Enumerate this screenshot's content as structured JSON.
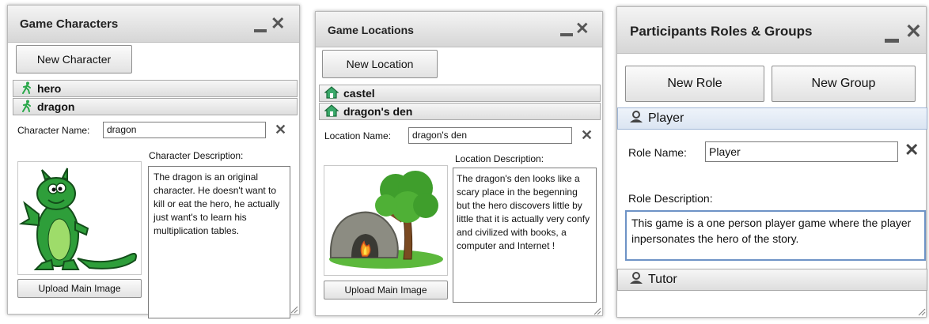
{
  "characters": {
    "title": "Game Characters",
    "new_button": "New Character",
    "items": [
      {
        "label": "hero",
        "icon": "walking-figure-icon"
      },
      {
        "label": "dragon",
        "icon": "walking-figure-icon"
      }
    ],
    "name_label": "Character Name:",
    "name_value": "dragon",
    "desc_label": "Character Description:",
    "desc_text": "The dragon is an original character. He doesn't want to kill or eat the hero, he actually just want's to learn his multiplication tables.",
    "upload_button": "Upload Main Image"
  },
  "locations": {
    "title": "Game Locations",
    "new_button": "New Location",
    "items": [
      {
        "label": "castel",
        "icon": "house-icon"
      },
      {
        "label": "dragon's den",
        "icon": "house-icon"
      }
    ],
    "name_label": "Location Name:",
    "name_value": "dragon's den",
    "desc_label": "Location Description:",
    "desc_text": "The dragon's den looks like a scary place in the begenning but the hero discovers little by little that it is actually very confy and civilized with books, a computer and Internet !",
    "upload_button": "Upload Main Image"
  },
  "roles": {
    "title": "Participants Roles & Groups",
    "new_role_button": "New Role",
    "new_group_button": "New Group",
    "items": [
      {
        "label": "Player",
        "icon": "person-icon"
      },
      {
        "label": "Tutor",
        "icon": "person-icon"
      }
    ],
    "name_label": "Role Name:",
    "name_value": "Player",
    "desc_label": "Role Description:",
    "desc_text": "This game is a one person player game where the player inpersonates the hero of the story."
  },
  "colors": {
    "dragon_green": "#2e9e3a",
    "icon_green": "#2aa84a",
    "focus_border": "#6e93c6",
    "selected_header": "#e4ecf7"
  }
}
